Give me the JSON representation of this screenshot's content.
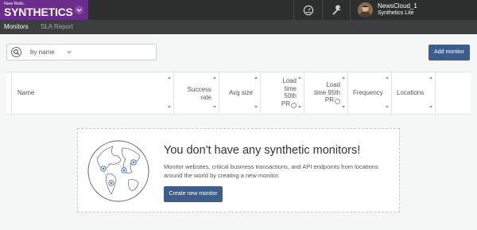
{
  "brand": {
    "small": "New Relic.",
    "name": "SYNTHETICS"
  },
  "topbar": {
    "user_name": "NewsCloud_1",
    "account": "Synthetics Lite"
  },
  "tabs": [
    {
      "label": "Monitors",
      "active": true
    },
    {
      "label": "SLA Report",
      "active": false
    }
  ],
  "search": {
    "filter_label": "by name"
  },
  "add_monitor_label": "Add monitor",
  "columns": [
    {
      "lines": [
        "Name"
      ]
    },
    {
      "lines": [
        "Success",
        "rate"
      ]
    },
    {
      "lines": [
        "Avg size"
      ]
    },
    {
      "lines": [
        "Load",
        "time",
        "50th",
        "PR"
      ],
      "help": true
    },
    {
      "lines": [
        "Load",
        "time 95th",
        "PR"
      ],
      "help": true
    },
    {
      "lines": [
        "Frequency"
      ]
    },
    {
      "lines": [
        "Locations"
      ]
    }
  ],
  "empty_state": {
    "title": "You don't have any synthetic monitors!",
    "description": "Monitor websites, critical business transactions, and API endpoints from locations around the world by creating a new monitor.",
    "button_label": "Create new monitor"
  },
  "colors": {
    "brand_purple": "#6b2c8c",
    "topbar": "#2d2f2f",
    "subnav": "#3c3f3f",
    "button_blue": "#3d5d8a",
    "globe_accent": "#5a7cb0"
  }
}
